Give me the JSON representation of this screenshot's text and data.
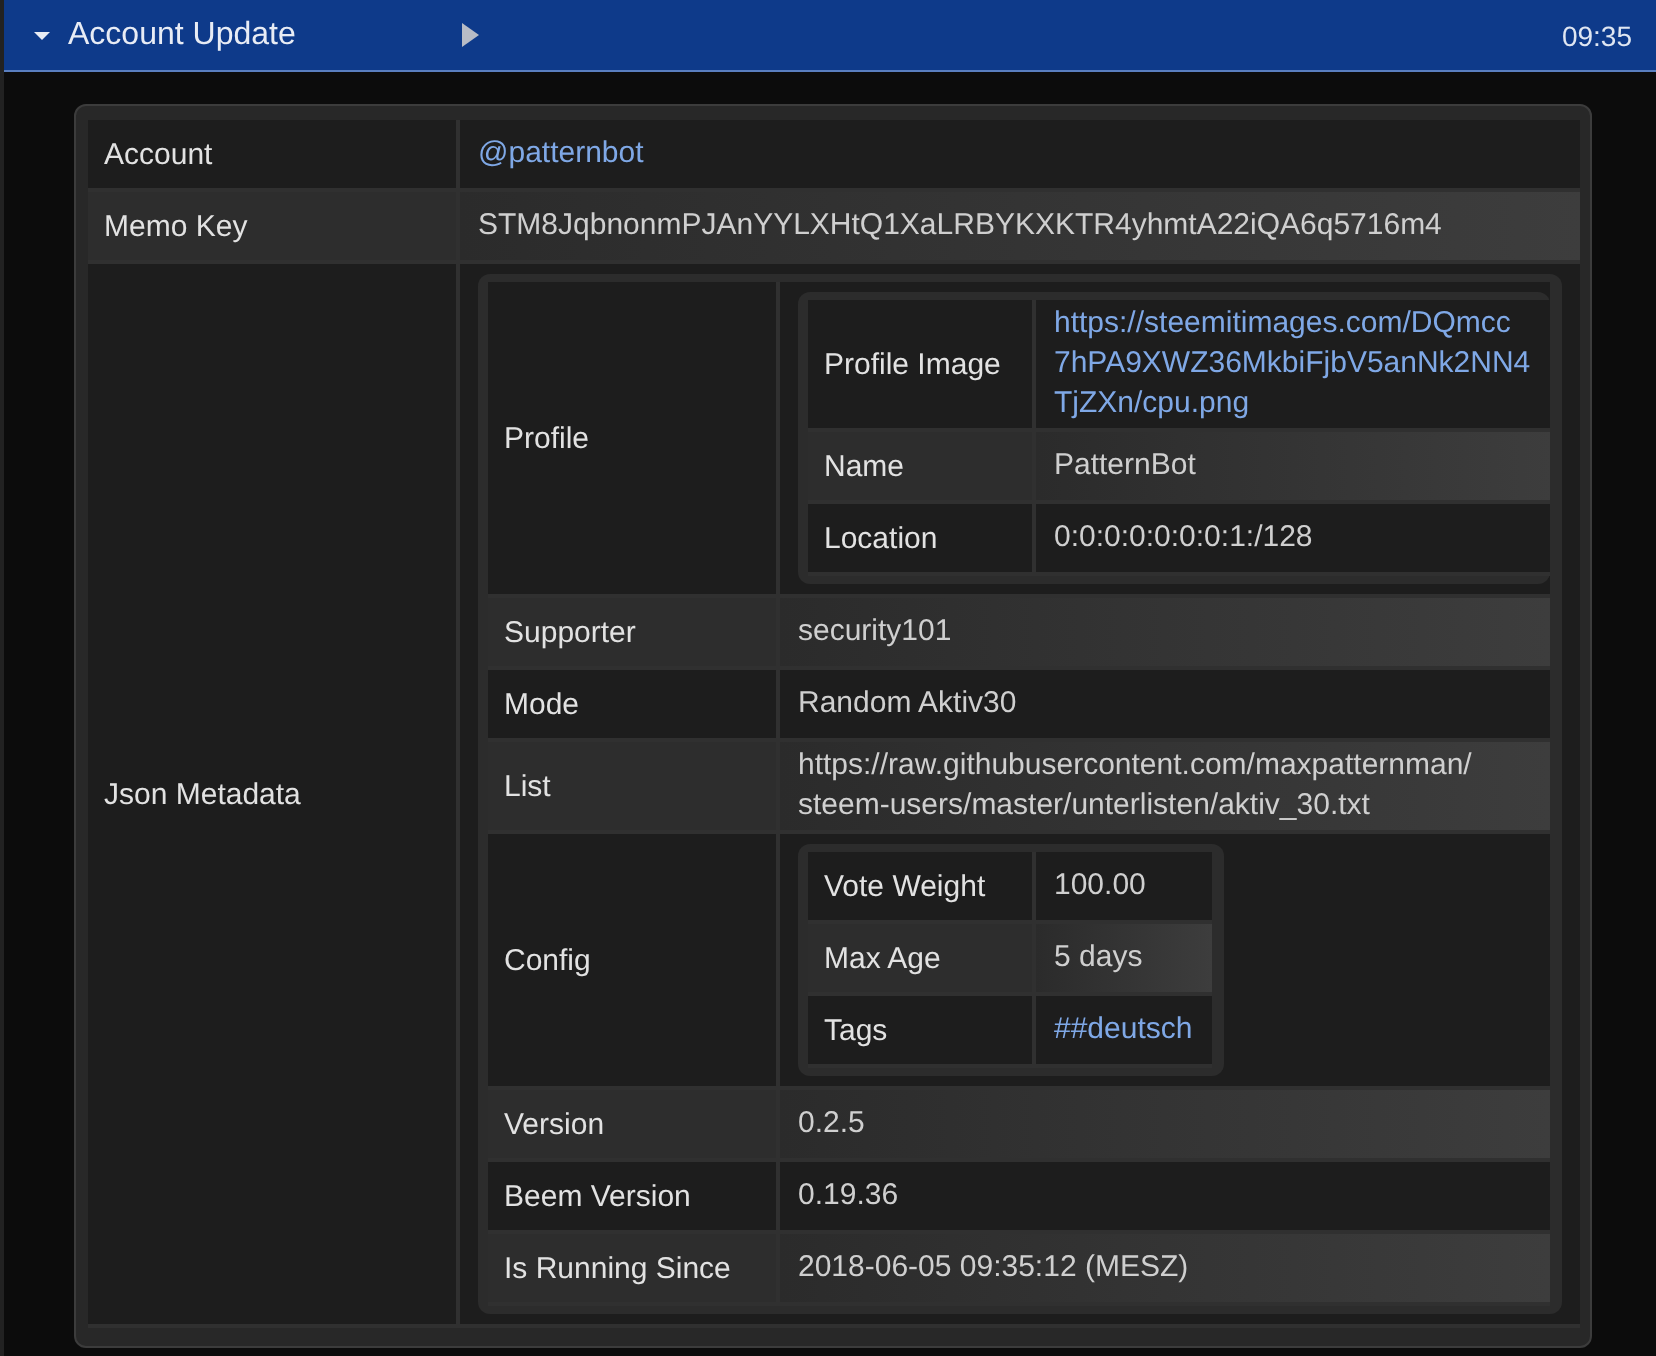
{
  "header": {
    "expanded": true,
    "title": "Account Update",
    "time": "09:35"
  },
  "fields": [
    {
      "key": "Account",
      "value": {
        "kind": "link",
        "lines": [
          "@patternbot"
        ]
      }
    },
    {
      "key": "Memo Key",
      "value": {
        "kind": "text",
        "lines": [
          "STM8JqbnonmPJAnYYLXHtQ1XaLRBYKXKTR4yhmtA22iQA6q5716m4"
        ]
      }
    },
    {
      "key": "Json Metadata",
      "value": {
        "kind": "table",
        "rows": [
          {
            "key": "Profile",
            "value": {
              "kind": "table",
              "rows": [
                {
                  "key": "Profile Image",
                  "value": {
                    "kind": "link",
                    "lines": [
                      "https://steemitimages.com/DQmcc",
                      "7hPA9XWZ36MkbiFjbV5anNk2NN4",
                      "TjZXn/cpu.png"
                    ]
                  }
                },
                {
                  "key": "Name",
                  "value": {
                    "kind": "text",
                    "lines": [
                      "PatternBot"
                    ]
                  }
                },
                {
                  "key": "Location",
                  "value": {
                    "kind": "text",
                    "lines": [
                      "0:0:0:0:0:0:0:1:/128"
                    ]
                  }
                }
              ]
            }
          },
          {
            "key": "Supporter",
            "value": {
              "kind": "text",
              "lines": [
                "security101"
              ]
            }
          },
          {
            "key": "Mode",
            "value": {
              "kind": "text",
              "lines": [
                "Random Aktiv30"
              ]
            }
          },
          {
            "key": "List",
            "value": {
              "kind": "text",
              "lines": [
                "https://raw.githubusercontent.com/maxpatternman/",
                "steem-users/master/unterlisten/aktiv_30.txt"
              ]
            }
          },
          {
            "key": "Config",
            "value": {
              "kind": "table",
              "rows": [
                {
                  "key": "Vote Weight",
                  "value": {
                    "kind": "text",
                    "lines": [
                      "100.00"
                    ]
                  }
                },
                {
                  "key": "Max Age",
                  "value": {
                    "kind": "text",
                    "lines": [
                      "5 days"
                    ]
                  }
                },
                {
                  "key": "Tags",
                  "value": {
                    "kind": "link",
                    "lines": [
                      "##deutsch"
                    ]
                  }
                }
              ]
            }
          },
          {
            "key": "Version",
            "value": {
              "kind": "text",
              "lines": [
                "0.2.5"
              ]
            }
          },
          {
            "key": "Beem Version",
            "value": {
              "kind": "text",
              "lines": [
                "0.19.36"
              ]
            }
          },
          {
            "key": "Is Running Since",
            "value": {
              "kind": "text",
              "lines": [
                "2018-06-05 09:35:12 (MESZ)"
              ]
            }
          }
        ]
      }
    }
  ]
}
